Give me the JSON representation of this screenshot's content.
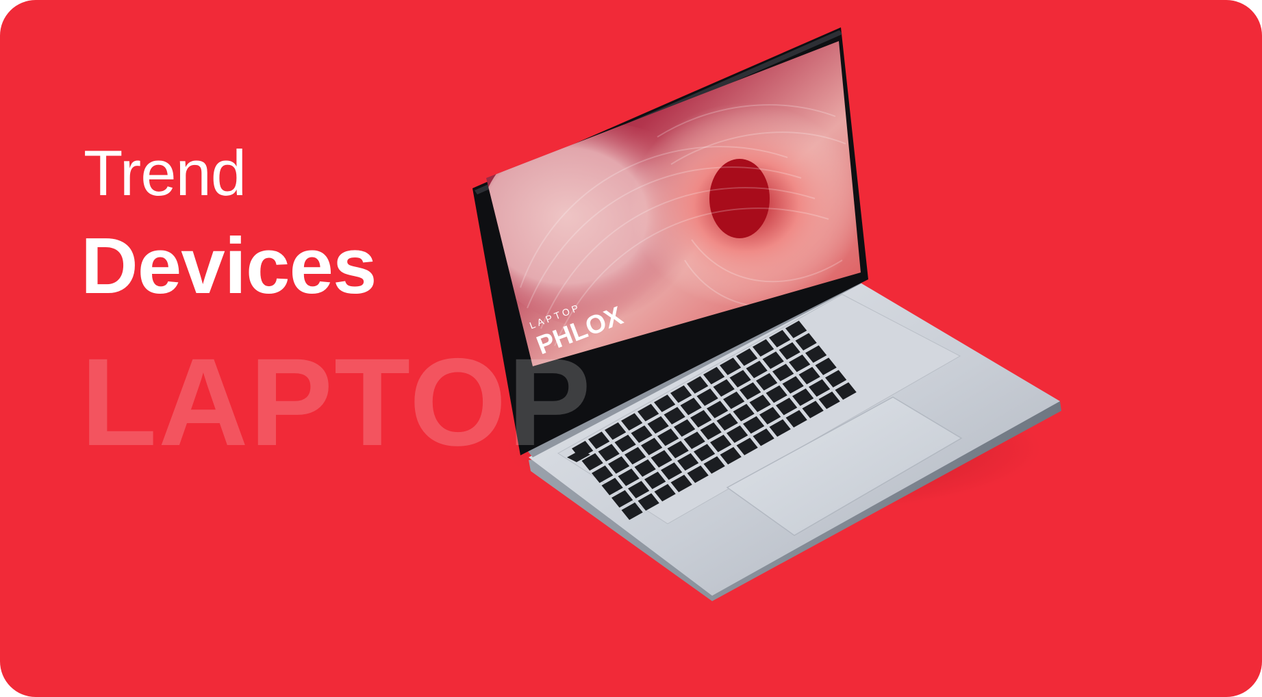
{
  "card": {
    "background_color": "#f12a38"
  },
  "hero": {
    "eyebrow": "Trend",
    "headline": "Devices",
    "watermark": "LAPTOP"
  },
  "laptop": {
    "screen_small_label": "LAPTOP",
    "screen_brand": "PHLOX"
  }
}
